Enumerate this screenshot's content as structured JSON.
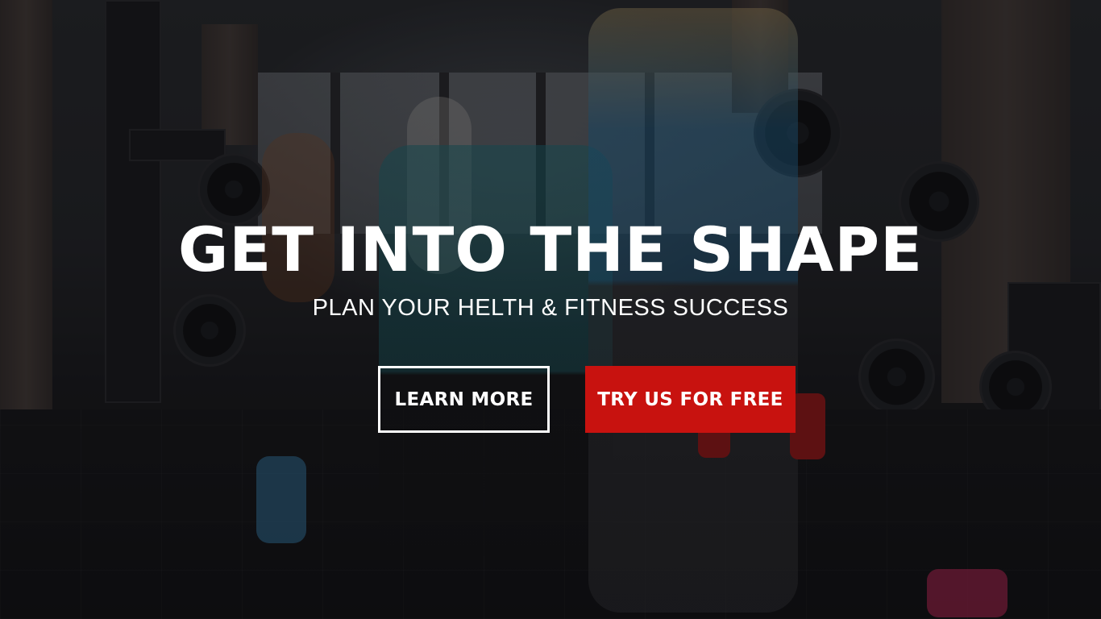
{
  "hero": {
    "headline": "GET INTO THE SHAPE",
    "subheadline": "PLAN YOUR HELTH & FITNESS SUCCESS",
    "background": "gym-training-photo"
  },
  "actions": {
    "learn_more_label": "LEARN MORE",
    "try_free_label": "TRY US FOR FREE"
  },
  "colors": {
    "primary_button": "#c8120f",
    "outline_button_border": "#ffffff",
    "text": "#ffffff",
    "overlay": "rgba(8,8,12,0.45)"
  }
}
